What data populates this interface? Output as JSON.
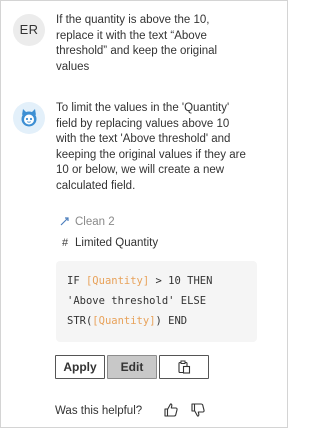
{
  "user_message": {
    "avatar_initials": "ER",
    "lines": [
      "If the quantity is above the 10,",
      "replace it with the text “Above",
      "threshold” and keep the original",
      "values"
    ]
  },
  "assistant_message": {
    "avatar_icon": "bot-icon",
    "lines": [
      "To limit the values in the 'Quantity'",
      "field by replacing values above 10",
      "with the text 'Above threshold' and",
      "keeping the original values if they are",
      "10 or below, we will create a new",
      "calculated field."
    ],
    "datasource": {
      "icon": "datasource-link-icon",
      "name": "Clean 2"
    },
    "field": {
      "icon": "hash-field-icon",
      "name": "Limited Quantity"
    },
    "code": {
      "if_kw": "IF",
      "field_ref": "[Quantity]",
      "cond_rest": "> 10 THEN",
      "then_value": "'Above threshold' ELSE",
      "str_fn": "STR(",
      "close": ") END"
    }
  },
  "actions": {
    "apply_label": "Apply",
    "edit_label": "Edit",
    "copy_icon": "copy-clipboard-icon"
  },
  "feedback": {
    "prompt": "Was this helpful?",
    "up_icon": "thumbs-up-icon",
    "down_icon": "thumbs-down-icon"
  },
  "colors": {
    "field_ref": "#e8a25a",
    "bot_avatar_bg": "#e3f0fa",
    "bot_icon": "#3d8fd3",
    "code_bg": "#f5f5f5",
    "edit_button_bg": "#c8c8c8"
  }
}
